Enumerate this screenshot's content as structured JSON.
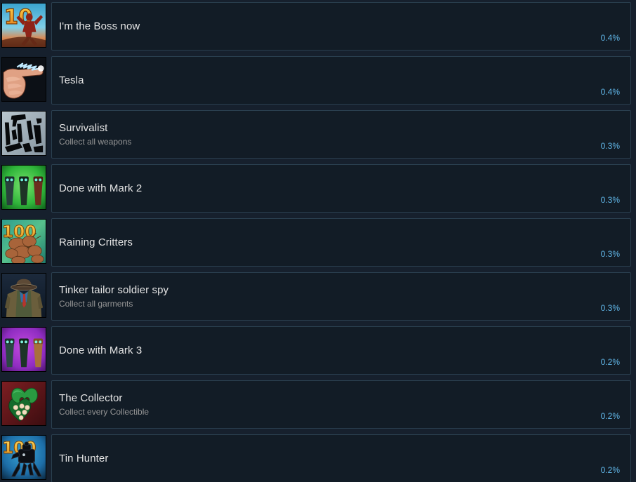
{
  "page": {
    "type": "steam-achievements-list",
    "background_color": "#16202d",
    "accent_color": "#60b5e6",
    "title_color": "#e5e5e5",
    "description_color": "#969696"
  },
  "achievements": [
    {
      "title": "I'm the Boss now",
      "description": "",
      "percent": "0.4%",
      "icon_name": "achievement-icon-im-the-boss-now",
      "icon_art": "ten-red-figure-blue-sky"
    },
    {
      "title": "Tesla",
      "description": "",
      "percent": "0.4%",
      "icon_name": "achievement-icon-tesla",
      "icon_art": "pointing-hand-lightning"
    },
    {
      "title": "Survivalist",
      "description": "Collect all weapons",
      "percent": "0.3%",
      "icon_name": "achievement-icon-survivalist",
      "icon_art": "black-weapons-on-grey"
    },
    {
      "title": "Done with Mark 2",
      "description": "",
      "percent": "0.3%",
      "icon_name": "achievement-icon-done-with-mark-2",
      "icon_art": "three-figures-green"
    },
    {
      "title": "Raining Critters",
      "description": "",
      "percent": "0.3%",
      "icon_name": "achievement-icon-raining-critters",
      "icon_art": "hundred-critters-teal"
    },
    {
      "title": "Tinker tailor soldier spy",
      "description": "Collect all garments",
      "percent": "0.3%",
      "icon_name": "achievement-icon-tinker-tailor-soldier-spy",
      "icon_art": "invisible-man-hat-coat"
    },
    {
      "title": "Done with Mark 3",
      "description": "",
      "percent": "0.2%",
      "icon_name": "achievement-icon-done-with-mark-3",
      "icon_art": "three-figures-purple"
    },
    {
      "title": "The Collector",
      "description": "Collect every Collectible",
      "percent": "0.2%",
      "icon_name": "achievement-icon-the-collector",
      "icon_art": "green-heart-chocolate-box"
    },
    {
      "title": "Tin Hunter",
      "description": "",
      "percent": "0.2%",
      "icon_name": "achievement-icon-tin-hunter",
      "icon_art": "hundred-black-robot-blue"
    }
  ]
}
